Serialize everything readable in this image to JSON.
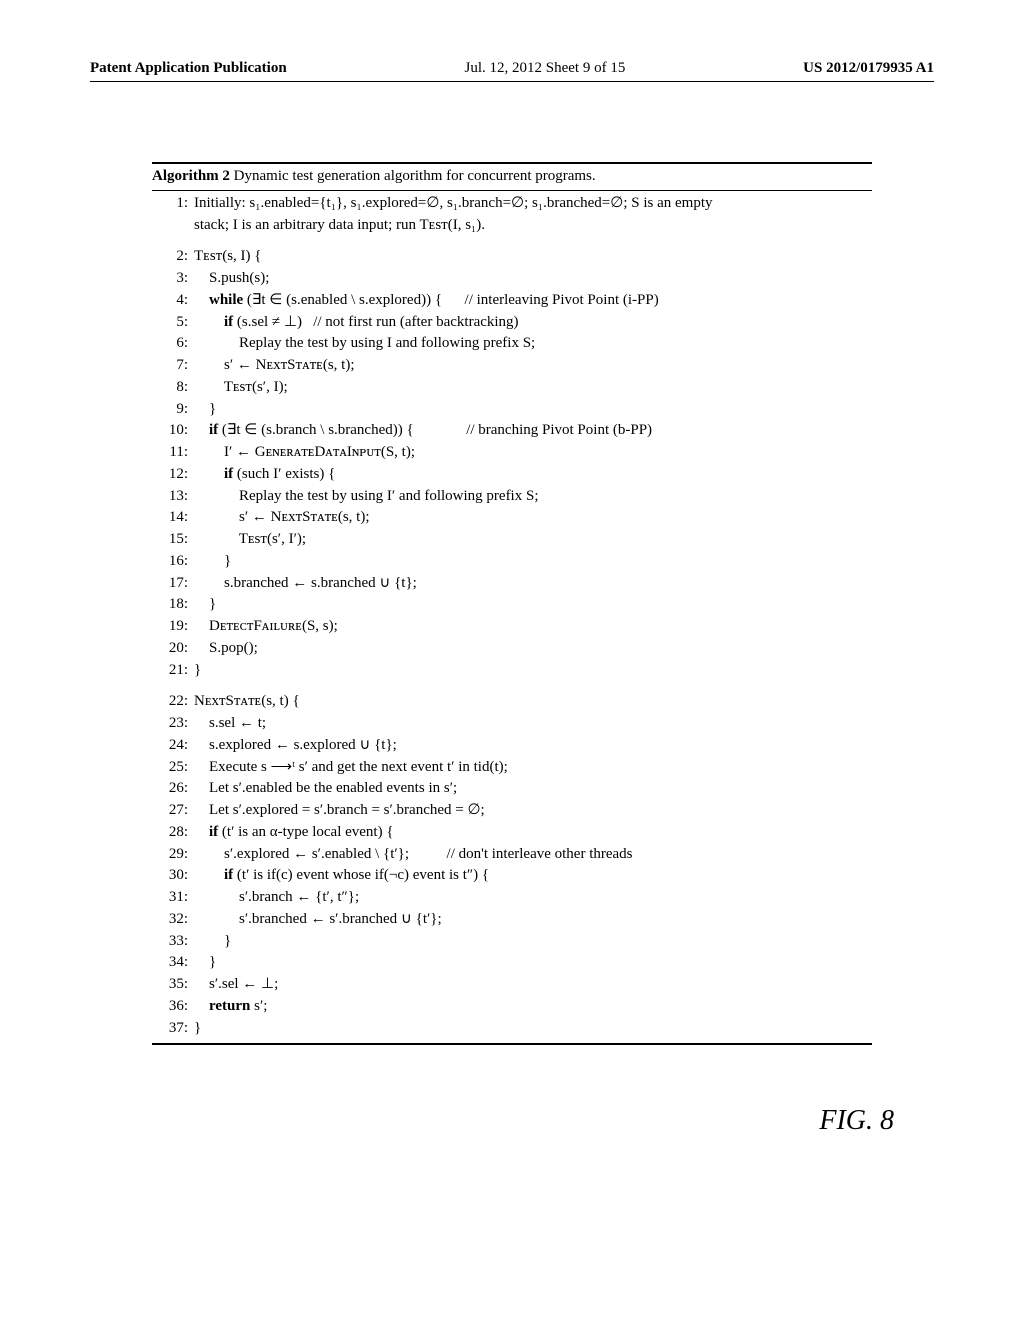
{
  "header": {
    "left": "Patent Application Publication",
    "mid": "Jul. 12, 2012  Sheet 9 of 15",
    "right": "US 2012/0179935 A1"
  },
  "alg": {
    "title_prefix": "Algorithm 2",
    "title_rest": " Dynamic test generation algorithm for concurrent programs.",
    "l1": "Initially: s₁.enabled={t₁}, s₁.explored=∅, s₁.branch=∅; s₁.branched=∅; S is an empty",
    "l1b": "stack; I is an arbitrary data input; run Tᴇsᴛ(I, s₁).",
    "l2": "Tᴇsᴛ(s, I) {",
    "l3": "S.push(s);",
    "l4a": "while",
    "l4b": " (∃t ∈ (s.enabled \\ s.explored)) {",
    "l4c": "      // interleaving Pivot Point (i-PP)",
    "l5a": "if",
    "l5b": " (s.sel ≠ ⊥)   // not first run (after backtracking)",
    "l6": "Replay the test by using I and following prefix S;",
    "l7": "s′ ← NᴇxᴛSᴛᴀᴛᴇ(s, t);",
    "l8": "Tᴇsᴛ(s′, I);",
    "l9": "}",
    "l10a": "if",
    "l10b": " (∃t ∈ (s.branch \\ s.branched)) {",
    "l10c": "              // branching Pivot Point (b-PP)",
    "l11": "I′ ← GᴇɴᴇʀᴀᴛᴇDᴀᴛᴀIɴᴘᴜᴛ(S, t);",
    "l12a": "if",
    "l12b": " (such I′ exists) {",
    "l13": "Replay the test by using I′ and following prefix S;",
    "l14": "s′ ← NᴇxᴛSᴛᴀᴛᴇ(s, t);",
    "l15": "Tᴇsᴛ(s′, I′);",
    "l16": "}",
    "l17": "s.branched ← s.branched ∪ {t};",
    "l18": "}",
    "l19": "DᴇᴛᴇᴄᴛFᴀɪʟᴜʀᴇ(S, s);",
    "l20": "S.pop();",
    "l21": "}",
    "l22": "NᴇxᴛSᴛᴀᴛᴇ(s, t) {",
    "l23": "s.sel ← t;",
    "l24": "s.explored ← s.explored ∪ {t};",
    "l25": "Execute s ⟶ᵗ s′ and get the next event t′ in tid(t);",
    "l26": "Let s′.enabled be the enabled events in s′;",
    "l27": "Let s′.explored = s′.branch = s′.branched = ∅;",
    "l28a": "if",
    "l28b": " (t′ is an α-type local event) {",
    "l29a": "s′.explored ← s′.enabled \\ {t′};",
    "l29b": "          // don't interleave other threads",
    "l30a": "if",
    "l30b": " (t′ is if(c) event whose if(¬c) event is t″) {",
    "l31": "s′.branch ← {t′, t″};",
    "l32": "s′.branched ← s′.branched ∪ {t′};",
    "l33": "}",
    "l34": "}",
    "l35": "s′.sel ← ⊥;",
    "l36a": "return",
    "l36b": " s′;",
    "l37": "}"
  },
  "figure_label": "FIG. 8"
}
